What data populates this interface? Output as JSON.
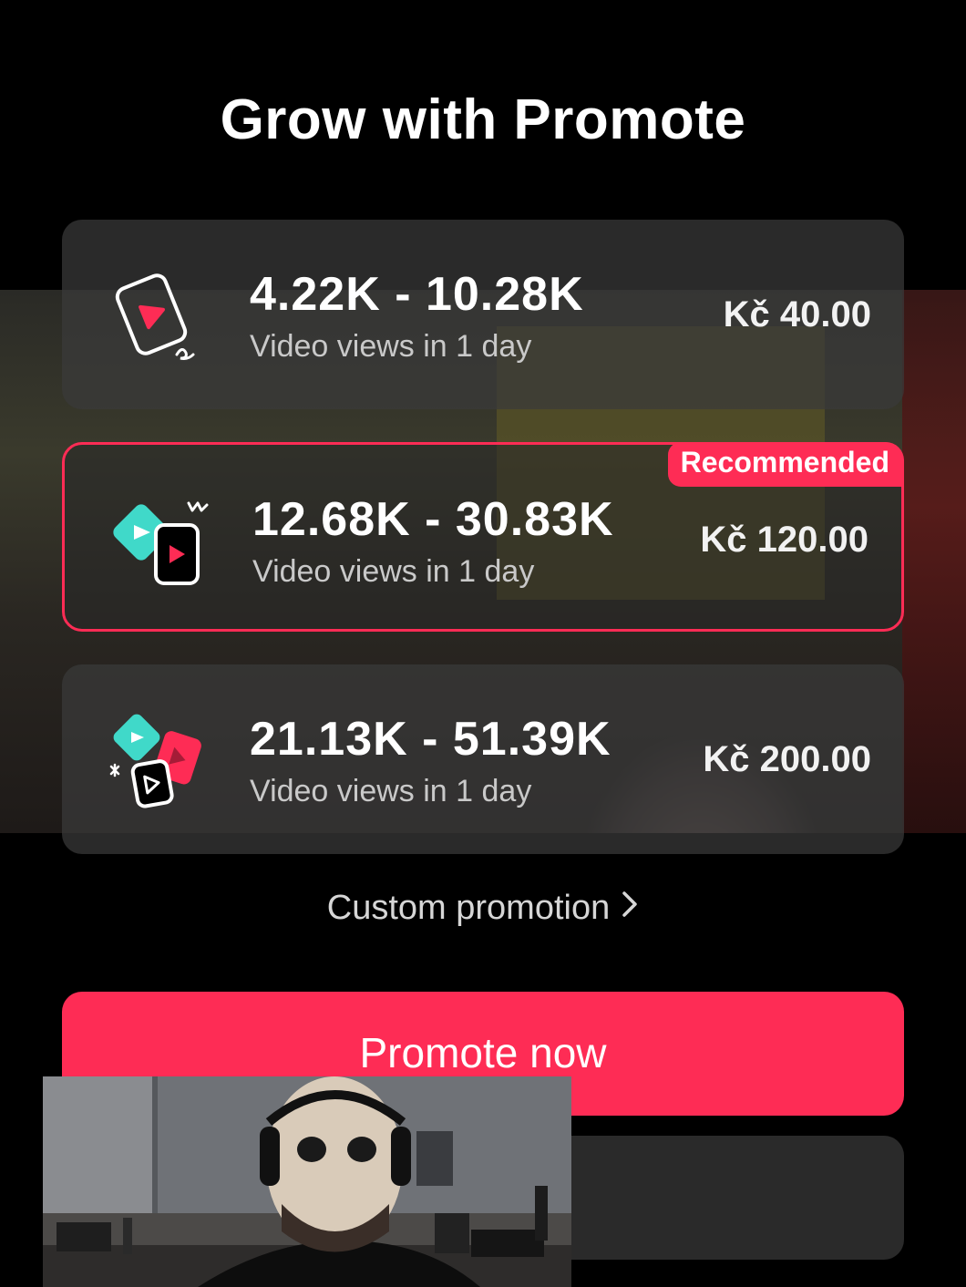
{
  "header": {
    "title": "Grow with Promote"
  },
  "options": [
    {
      "range": "4.22K - 10.28K",
      "subtitle": "Video views in 1 day",
      "price": "Kč 40.00"
    },
    {
      "range": "12.68K - 30.83K",
      "subtitle": "Video views in 1 day",
      "price": "Kč 120.00",
      "badge": "Recommended"
    },
    {
      "range": "21.13K - 51.39K",
      "subtitle": "Video views in 1 day",
      "price": "Kč 200.00"
    }
  ],
  "custom_promotion": {
    "label": "Custom promotion",
    "icon": "chevron-right-icon"
  },
  "actions": {
    "promote_label": "Promote now"
  },
  "colors": {
    "accent": "#fe2c55",
    "teal": "#40d9c9",
    "background": "#000000",
    "card": "#3a3a3a"
  },
  "icons": [
    "single-video-card-icon",
    "double-video-card-icon",
    "triple-video-card-icon"
  ]
}
